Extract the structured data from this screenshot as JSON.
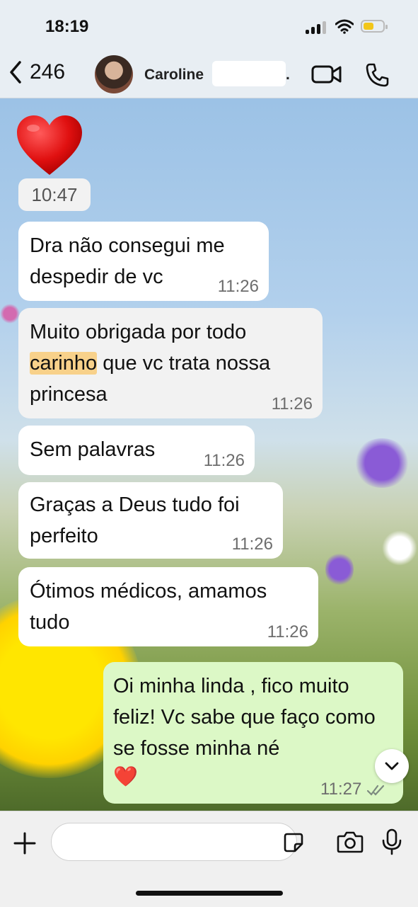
{
  "status_bar": {
    "time": "18:19"
  },
  "header": {
    "back_count": "246",
    "contact_name": "Caroline",
    "contact_suffix": "."
  },
  "messages": [
    {
      "text": "Dra não consegui me despedir de vc",
      "time": "11:26"
    },
    {
      "text_before": "Muito obrigada por todo",
      "highlight": "carinho",
      "text_after": "que vc trata nossa princesa",
      "time": "11:26"
    },
    {
      "text": "Sem palavras",
      "time": "11:26"
    },
    {
      "text": "Graças a Deus tudo foi perfeito",
      "time": "11:26"
    },
    {
      "text": "Ótimos médicos, amamos tudo",
      "time": "11:26"
    },
    {
      "text": "Oi minha linda , fico muito feliz! Vc sabe que faço como se fosse minha né",
      "emoji": "❤️",
      "time": "11:27"
    }
  ],
  "heart_message_time": "10:47",
  "input": {
    "placeholder": ""
  },
  "colors": {
    "outgoing_bubble": "#dcf8c6",
    "incoming_bubble": "#f2f2f2",
    "highlight": "#f8d18a",
    "battery": "#f2c61a"
  }
}
